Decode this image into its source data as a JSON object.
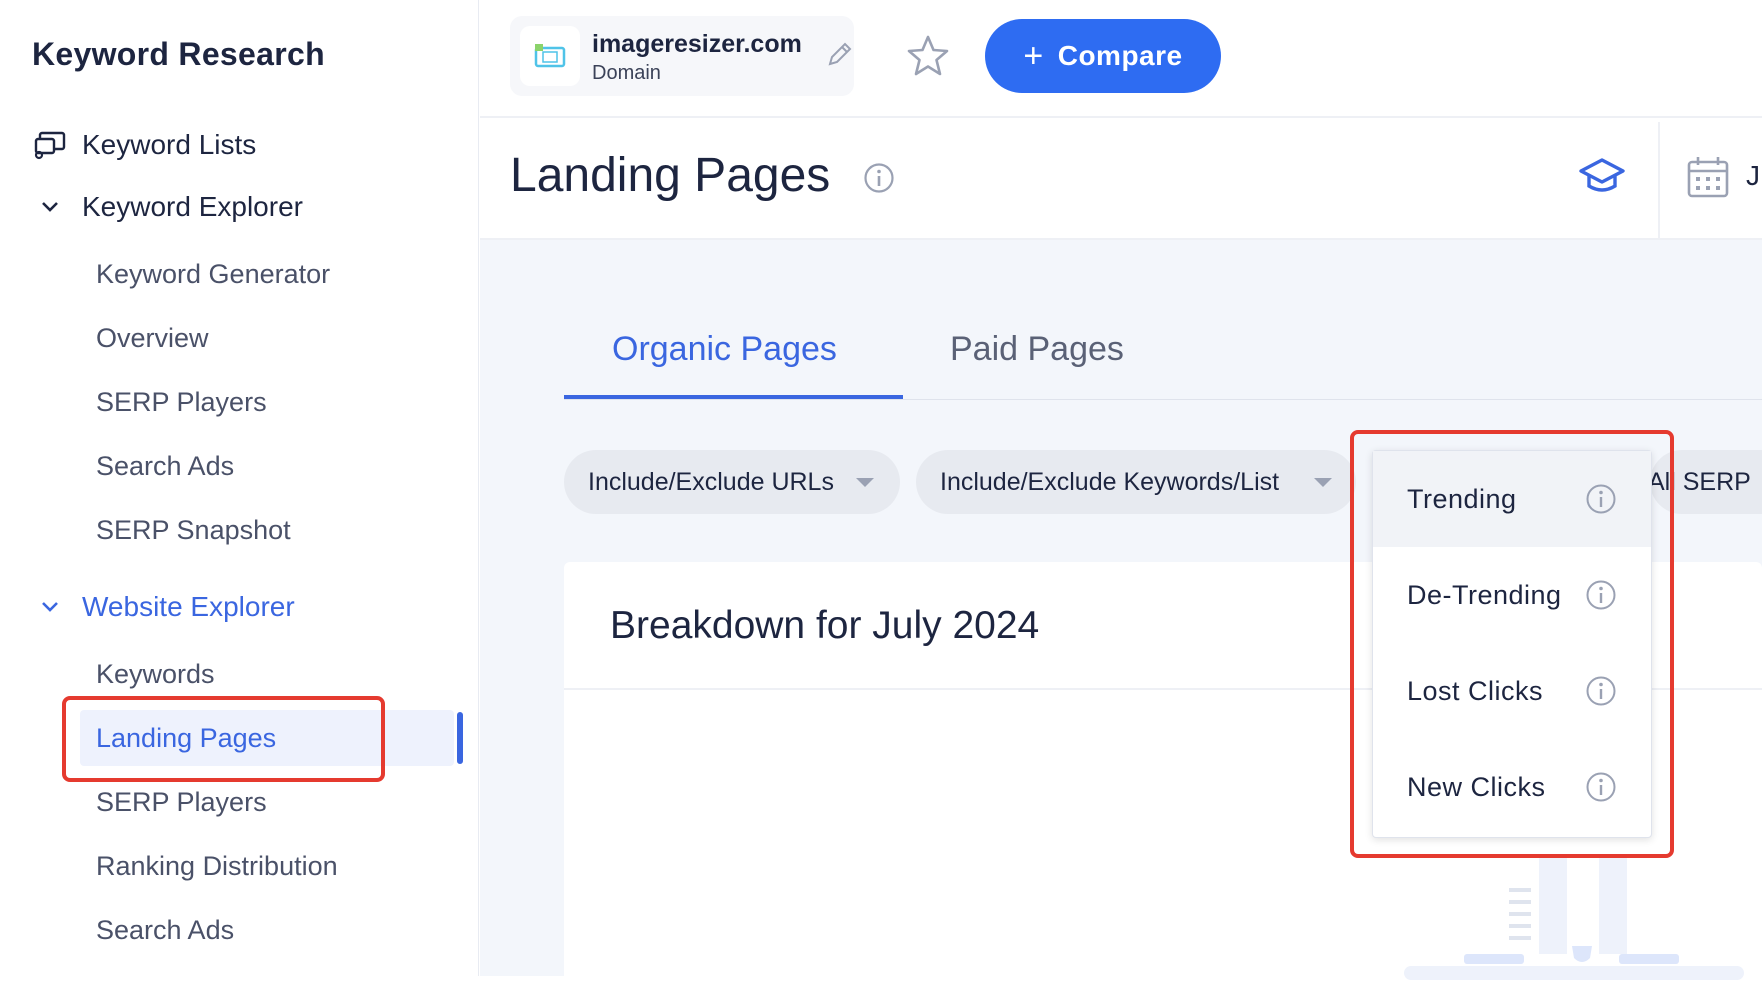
{
  "sidebar": {
    "title": "Keyword Research",
    "keyword_lists": "Keyword Lists",
    "keyword_explorer": {
      "label": "Keyword Explorer",
      "items": [
        "Keyword Generator",
        "Overview",
        "SERP Players",
        "Search Ads",
        "SERP Snapshot"
      ]
    },
    "website_explorer": {
      "label": "Website Explorer",
      "items": [
        "Keywords",
        "Landing Pages",
        "SERP Players",
        "Ranking Distribution",
        "Search Ads"
      ],
      "active": "Landing Pages"
    }
  },
  "topbar": {
    "domain": "imageresizer.com",
    "domain_type": "Domain",
    "compare_plus": "+",
    "compare_label": "Compare"
  },
  "header": {
    "title": "Landing Pages",
    "date_partial": "J"
  },
  "tabs": {
    "organic": "Organic Pages",
    "paid": "Paid Pages",
    "active": "Organic Pages"
  },
  "filters": {
    "urls": "Include/Exclude URLs",
    "keywords": "Include/Exclude Keywords/List",
    "serp_partial": "All SERP"
  },
  "card": {
    "title": "Breakdown for July 2024"
  },
  "dropdown": {
    "items": [
      "Trending",
      "De-Trending",
      "Lost Clicks",
      "New Clicks"
    ],
    "hovered": "Trending"
  },
  "colors": {
    "accent": "#2e6cf2",
    "active_text": "#3a66e0",
    "highlight_box": "#e53a2f",
    "title": "#1d2540",
    "main_bg": "#f3f6fb"
  }
}
